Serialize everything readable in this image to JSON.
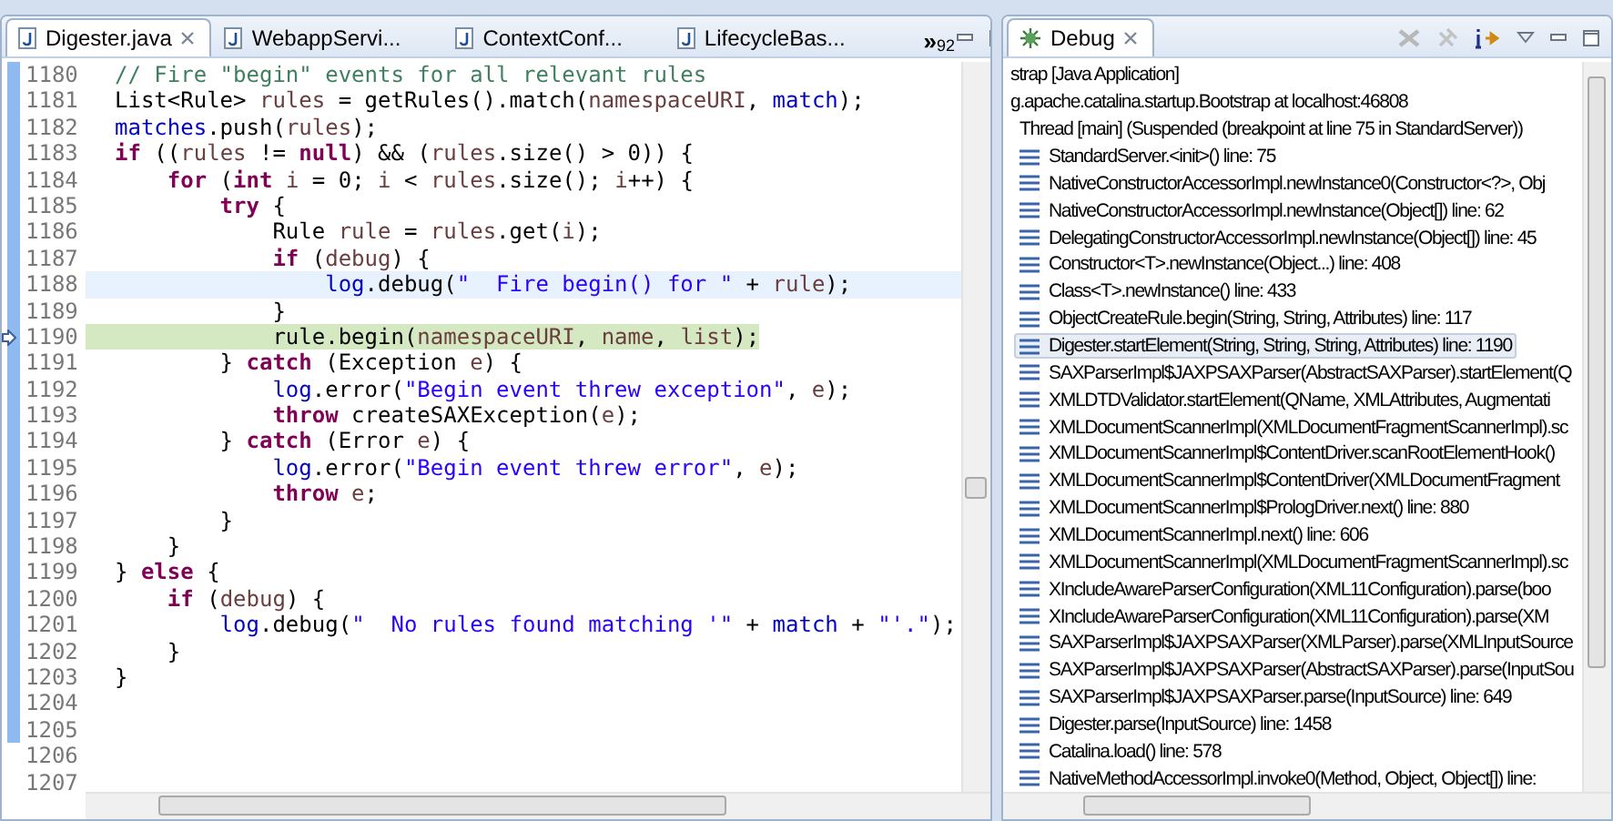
{
  "editor": {
    "tabs": [
      {
        "label": "Digester.java",
        "selected": true,
        "closable": true
      },
      {
        "label": "WebappServi...",
        "selected": false,
        "closable": false
      },
      {
        "label": "ContextConf...",
        "selected": false,
        "closable": false
      },
      {
        "label": "LifecycleBas...",
        "selected": false,
        "closable": false
      }
    ],
    "overflow": {
      "symbol": "»",
      "count": "92"
    },
    "lines": [
      {
        "number": "1180",
        "marked": true,
        "cursor_line": false,
        "instruction_pointer": false,
        "tokens": [
          {
            "kind": "comment",
            "text": "// Fire \"begin\" events for all relevant rules"
          }
        ]
      },
      {
        "number": "1181",
        "marked": true,
        "cursor_line": false,
        "instruction_pointer": false,
        "tokens": [
          {
            "kind": "plain",
            "text": "List<Rule> "
          },
          {
            "kind": "local",
            "text": "rules"
          },
          {
            "kind": "plain",
            "text": " = getRules().match("
          },
          {
            "kind": "local",
            "text": "namespaceURI"
          },
          {
            "kind": "plain",
            "text": ", "
          },
          {
            "kind": "field",
            "text": "match"
          },
          {
            "kind": "plain",
            "text": ");"
          }
        ]
      },
      {
        "number": "1182",
        "marked": true,
        "cursor_line": false,
        "instruction_pointer": false,
        "tokens": [
          {
            "kind": "field",
            "text": "matches"
          },
          {
            "kind": "plain",
            "text": ".push("
          },
          {
            "kind": "local",
            "text": "rules"
          },
          {
            "kind": "plain",
            "text": ");"
          }
        ]
      },
      {
        "number": "1183",
        "marked": true,
        "cursor_line": false,
        "instruction_pointer": false,
        "tokens": [
          {
            "kind": "keyword",
            "text": "if"
          },
          {
            "kind": "plain",
            "text": " (("
          },
          {
            "kind": "local",
            "text": "rules"
          },
          {
            "kind": "plain",
            "text": " != "
          },
          {
            "kind": "keyword",
            "text": "null"
          },
          {
            "kind": "plain",
            "text": ") && ("
          },
          {
            "kind": "local",
            "text": "rules"
          },
          {
            "kind": "plain",
            "text": ".size() > 0)) {"
          }
        ]
      },
      {
        "number": "1184",
        "marked": true,
        "cursor_line": false,
        "instruction_pointer": false,
        "tokens": [
          {
            "kind": "keyword",
            "text": "    for"
          },
          {
            "kind": "plain",
            "text": " ("
          },
          {
            "kind": "keyword",
            "text": "int "
          },
          {
            "kind": "local",
            "text": "i"
          },
          {
            "kind": "plain",
            "text": " = 0; "
          },
          {
            "kind": "local",
            "text": "i"
          },
          {
            "kind": "plain",
            "text": " < "
          },
          {
            "kind": "local",
            "text": "rules"
          },
          {
            "kind": "plain",
            "text": ".size(); "
          },
          {
            "kind": "local",
            "text": "i"
          },
          {
            "kind": "plain",
            "text": "++) {"
          }
        ]
      },
      {
        "number": "1185",
        "marked": true,
        "cursor_line": false,
        "instruction_pointer": false,
        "tokens": [
          {
            "kind": "keyword",
            "text": "        try"
          },
          {
            "kind": "plain",
            "text": " {"
          }
        ]
      },
      {
        "number": "1186",
        "marked": true,
        "cursor_line": false,
        "instruction_pointer": false,
        "tokens": [
          {
            "kind": "plain",
            "text": "            Rule "
          },
          {
            "kind": "local",
            "text": "rule"
          },
          {
            "kind": "plain",
            "text": " = "
          },
          {
            "kind": "local",
            "text": "rules"
          },
          {
            "kind": "plain",
            "text": ".get("
          },
          {
            "kind": "local",
            "text": "i"
          },
          {
            "kind": "plain",
            "text": ");"
          }
        ]
      },
      {
        "number": "1187",
        "marked": true,
        "cursor_line": false,
        "instruction_pointer": false,
        "tokens": [
          {
            "kind": "keyword",
            "text": "            if"
          },
          {
            "kind": "plain",
            "text": " ("
          },
          {
            "kind": "local",
            "text": "debug"
          },
          {
            "kind": "plain",
            "text": ") {"
          }
        ]
      },
      {
        "number": "1188",
        "marked": true,
        "cursor_line": true,
        "instruction_pointer": false,
        "tokens": [
          {
            "kind": "field",
            "text": "                log"
          },
          {
            "kind": "plain",
            "text": ".debug("
          },
          {
            "kind": "string",
            "text": "\"  Fire begin() for \""
          },
          {
            "kind": "plain",
            "text": " + "
          },
          {
            "kind": "local",
            "text": "rule"
          },
          {
            "kind": "plain",
            "text": ");"
          }
        ]
      },
      {
        "number": "1189",
        "marked": true,
        "cursor_line": false,
        "instruction_pointer": false,
        "tokens": [
          {
            "kind": "plain",
            "text": "            }"
          }
        ]
      },
      {
        "number": "1190",
        "marked": true,
        "cursor_line": false,
        "instruction_pointer": true,
        "tokens": [
          {
            "kind": "plain",
            "text": "            rule.begin("
          },
          {
            "kind": "local",
            "text": "namespaceURI"
          },
          {
            "kind": "plain",
            "text": ", "
          },
          {
            "kind": "local",
            "text": "name"
          },
          {
            "kind": "plain",
            "text": ", "
          },
          {
            "kind": "local",
            "text": "list"
          },
          {
            "kind": "plain",
            "text": ");"
          }
        ]
      },
      {
        "number": "1191",
        "marked": true,
        "cursor_line": false,
        "instruction_pointer": false,
        "tokens": [
          {
            "kind": "plain",
            "text": "        } "
          },
          {
            "kind": "keyword",
            "text": "catch"
          },
          {
            "kind": "plain",
            "text": " (Exception "
          },
          {
            "kind": "local",
            "text": "e"
          },
          {
            "kind": "plain",
            "text": ") {"
          }
        ]
      },
      {
        "number": "1192",
        "marked": true,
        "cursor_line": false,
        "instruction_pointer": false,
        "tokens": [
          {
            "kind": "field",
            "text": "            log"
          },
          {
            "kind": "plain",
            "text": ".error("
          },
          {
            "kind": "string",
            "text": "\"Begin event threw exception\""
          },
          {
            "kind": "plain",
            "text": ", "
          },
          {
            "kind": "local",
            "text": "e"
          },
          {
            "kind": "plain",
            "text": ");"
          }
        ]
      },
      {
        "number": "1193",
        "marked": true,
        "cursor_line": false,
        "instruction_pointer": false,
        "tokens": [
          {
            "kind": "keyword",
            "text": "            throw"
          },
          {
            "kind": "plain",
            "text": " createSAXException("
          },
          {
            "kind": "local",
            "text": "e"
          },
          {
            "kind": "plain",
            "text": ");"
          }
        ]
      },
      {
        "number": "1194",
        "marked": true,
        "cursor_line": false,
        "instruction_pointer": false,
        "tokens": [
          {
            "kind": "plain",
            "text": "        } "
          },
          {
            "kind": "keyword",
            "text": "catch"
          },
          {
            "kind": "plain",
            "text": " (Error "
          },
          {
            "kind": "local",
            "text": "e"
          },
          {
            "kind": "plain",
            "text": ") {"
          }
        ]
      },
      {
        "number": "1195",
        "marked": true,
        "cursor_line": false,
        "instruction_pointer": false,
        "tokens": [
          {
            "kind": "field",
            "text": "            log"
          },
          {
            "kind": "plain",
            "text": ".error("
          },
          {
            "kind": "string",
            "text": "\"Begin event threw error\""
          },
          {
            "kind": "plain",
            "text": ", "
          },
          {
            "kind": "local",
            "text": "e"
          },
          {
            "kind": "plain",
            "text": ");"
          }
        ]
      },
      {
        "number": "1196",
        "marked": true,
        "cursor_line": false,
        "instruction_pointer": false,
        "tokens": [
          {
            "kind": "keyword",
            "text": "            throw "
          },
          {
            "kind": "local",
            "text": "e"
          },
          {
            "kind": "plain",
            "text": ";"
          }
        ]
      },
      {
        "number": "1197",
        "marked": true,
        "cursor_line": false,
        "instruction_pointer": false,
        "tokens": [
          {
            "kind": "plain",
            "text": "        }"
          }
        ]
      },
      {
        "number": "1198",
        "marked": true,
        "cursor_line": false,
        "instruction_pointer": false,
        "tokens": [
          {
            "kind": "plain",
            "text": "    }"
          }
        ]
      },
      {
        "number": "1199",
        "marked": true,
        "cursor_line": false,
        "instruction_pointer": false,
        "tokens": [
          {
            "kind": "plain",
            "text": "} "
          },
          {
            "kind": "keyword",
            "text": "else"
          },
          {
            "kind": "plain",
            "text": " {"
          }
        ]
      },
      {
        "number": "1200",
        "marked": true,
        "cursor_line": false,
        "instruction_pointer": false,
        "tokens": [
          {
            "kind": "keyword",
            "text": "    if"
          },
          {
            "kind": "plain",
            "text": " ("
          },
          {
            "kind": "local",
            "text": "debug"
          },
          {
            "kind": "plain",
            "text": ") {"
          }
        ]
      },
      {
        "number": "1201",
        "marked": true,
        "cursor_line": false,
        "instruction_pointer": false,
        "tokens": [
          {
            "kind": "field",
            "text": "        log"
          },
          {
            "kind": "plain",
            "text": ".debug("
          },
          {
            "kind": "string",
            "text": "\"  No rules found matching '\""
          },
          {
            "kind": "plain",
            "text": " + "
          },
          {
            "kind": "field",
            "text": "match"
          },
          {
            "kind": "plain",
            "text": " + "
          },
          {
            "kind": "string",
            "text": "\"'.\""
          },
          {
            "kind": "plain",
            "text": ");"
          }
        ]
      },
      {
        "number": "1202",
        "marked": true,
        "cursor_line": false,
        "instruction_pointer": false,
        "tokens": [
          {
            "kind": "plain",
            "text": "    }"
          }
        ]
      },
      {
        "number": "1203",
        "marked": true,
        "cursor_line": false,
        "instruction_pointer": false,
        "tokens": [
          {
            "kind": "plain",
            "text": "}"
          }
        ]
      },
      {
        "number": "1204",
        "marked": true,
        "cursor_line": false,
        "instruction_pointer": false
      },
      {
        "number": "1205",
        "marked": true,
        "cursor_line": false,
        "instruction_pointer": false
      },
      {
        "number": "1206",
        "marked": false,
        "cursor_line": false,
        "instruction_pointer": false
      },
      {
        "number": "1207",
        "marked": false,
        "cursor_line": false,
        "instruction_pointer": false
      }
    ]
  },
  "debug": {
    "tab": {
      "label": "Debug",
      "selected": true
    },
    "tree": [
      {
        "label": "strap [Java Application]",
        "selected": false,
        "children": [
          {
            "label": "g.apache.catalina.startup.Bootstrap at localhost:46808",
            "selected": false,
            "children": [
              {
                "label": "Thread [main] (Suspended (breakpoint at line 75 in StandardServer))",
                "selected": false,
                "children": [
                  {
                    "label": "StandardServer.<init>() line: 75",
                    "selected": false
                  },
                  {
                    "label": "NativeConstructorAccessorImpl.newInstance0(Constructor<?>, Obj",
                    "selected": false
                  },
                  {
                    "label": "NativeConstructorAccessorImpl.newInstance(Object[]) line: 62",
                    "selected": false
                  },
                  {
                    "label": "DelegatingConstructorAccessorImpl.newInstance(Object[]) line: 45",
                    "selected": false
                  },
                  {
                    "label": "Constructor<T>.newInstance(Object...) line: 408",
                    "selected": false
                  },
                  {
                    "label": "Class<T>.newInstance() line: 433",
                    "selected": false
                  },
                  {
                    "label": "ObjectCreateRule.begin(String, String, Attributes) line: 117",
                    "selected": false
                  },
                  {
                    "label": "Digester.startElement(String, String, String, Attributes) line: 1190",
                    "selected": true
                  },
                  {
                    "label": "SAXParserImpl$JAXPSAXParser(AbstractSAXParser).startElement(Q",
                    "selected": false
                  },
                  {
                    "label": "XMLDTDValidator.startElement(QName, XMLAttributes, Augmentati",
                    "selected": false
                  },
                  {
                    "label": "XMLDocumentScannerImpl(XMLDocumentFragmentScannerImpl).sc",
                    "selected": false
                  },
                  {
                    "label": "XMLDocumentScannerImpl$ContentDriver.scanRootElementHook()",
                    "selected": false
                  },
                  {
                    "label": "XMLDocumentScannerImpl$ContentDriver(XMLDocumentFragment",
                    "selected": false
                  },
                  {
                    "label": "XMLDocumentScannerImpl$PrologDriver.next() line: 880",
                    "selected": false
                  },
                  {
                    "label": "XMLDocumentScannerImpl.next() line: 606",
                    "selected": false
                  },
                  {
                    "label": "XMLDocumentScannerImpl(XMLDocumentFragmentScannerImpl).sc",
                    "selected": false
                  },
                  {
                    "label": "XIncludeAwareParserConfiguration(XML11Configuration).parse(boo",
                    "selected": false
                  },
                  {
                    "label": "XIncludeAwareParserConfiguration(XML11Configuration).parse(XM",
                    "selected": false
                  },
                  {
                    "label": "SAXParserImpl$JAXPSAXParser(XMLParser).parse(XMLInputSource",
                    "selected": false
                  },
                  {
                    "label": "SAXParserImpl$JAXPSAXParser(AbstractSAXParser).parse(InputSou",
                    "selected": false
                  },
                  {
                    "label": "SAXParserImpl$JAXPSAXParser.parse(InputSource) line: 649",
                    "selected": false
                  },
                  {
                    "label": "Digester.parse(InputSource) line: 1458",
                    "selected": false
                  },
                  {
                    "label": "Catalina.load() line: 578",
                    "selected": false
                  },
                  {
                    "label": "NativeMethodAccessorImpl.invoke0(Method, Object, Object[]) line:",
                    "selected": false
                  }
                ]
              }
            ]
          }
        ]
      }
    ]
  }
}
